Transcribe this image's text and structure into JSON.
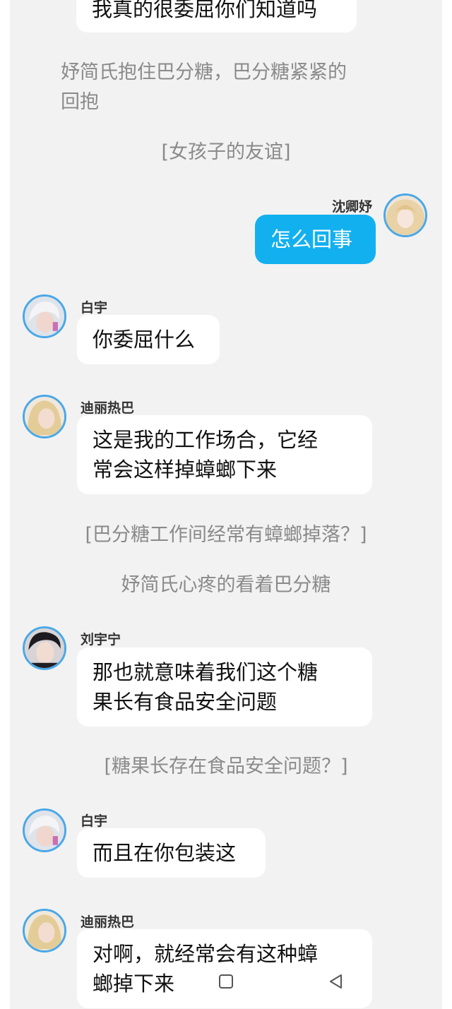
{
  "messages": [
    {
      "kind": "bubble",
      "text": "我真的很委屈你们知道吗"
    },
    {
      "kind": "narration",
      "text": "妤简氏抱住巴分糖，巴分糖紧紧的\n回抱"
    },
    {
      "kind": "narration",
      "text": "[女孩子的友谊]"
    },
    {
      "kind": "bubble",
      "sender": "沈卿妤",
      "avatar": "blonde-girl-avatar",
      "text": "怎么回事",
      "outgoing": true
    },
    {
      "kind": "bubble",
      "sender": "白宇",
      "avatar": "white-hair-man-avatar",
      "text": "你委屈什么"
    },
    {
      "kind": "bubble",
      "sender": "迪丽热巴",
      "avatar": "blonde-woman-avatar",
      "text": "这是我的工作场合，它经\n常会这样掉蟑螂下来"
    },
    {
      "kind": "narration",
      "text": "[巴分糖工作间经常有蟑螂掉落？]"
    },
    {
      "kind": "narration",
      "text": "妤简氏心疼的看着巴分糖"
    },
    {
      "kind": "bubble",
      "sender": "刘宇宁",
      "avatar": "dark-hair-man-avatar",
      "text": "那也就意味着我们这个糖\n果长有食品安全问题"
    },
    {
      "kind": "narration",
      "text": "[糖果长存在食品安全问题？]"
    },
    {
      "kind": "bubble",
      "sender": "白宇",
      "avatar": "white-hair-man-avatar",
      "text": "而且在你包装这"
    },
    {
      "kind": "bubble",
      "sender": "迪丽热巴",
      "avatar": "blonde-woman-avatar",
      "text": "对啊，就经常会有这种蟑\n螂掉下来"
    }
  ],
  "navbar": {
    "home_icon": "square-home-icon",
    "back_icon": "triangle-back-icon"
  },
  "colors": {
    "outgoing_bubble": "#13b0f0",
    "incoming_bubble": "#ffffff",
    "background": "#f2f2f2",
    "avatar_ring": "#4aa8e8",
    "narration": "#8a8a8a"
  }
}
